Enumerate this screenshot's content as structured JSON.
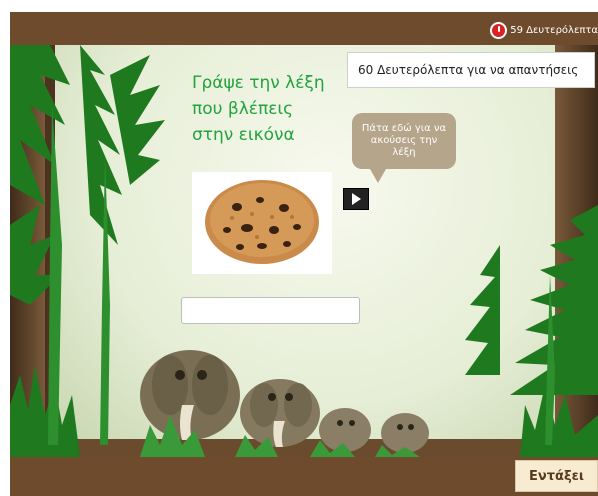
{
  "header": {
    "timer_text": "59 Δευτερόλεπτα",
    "icon": "stopwatch-icon"
  },
  "tooltip": {
    "text": "60 Δευτερόλεπτα για να απαντήσεις"
  },
  "exercise": {
    "instruction": "Γράψε την λέξη\nπου βλέπεις\nστην εικόνα",
    "audio_hint": "Πάτα εδώ για να ακούσεις την λέξη",
    "play_icon": "play-icon",
    "image_subject": "cookie",
    "answer_value": "",
    "answer_placeholder": ""
  },
  "footer": {
    "ok_label": "Εντάξει"
  },
  "colors": {
    "wood": "#6e4b2d",
    "title_green": "#22a33c",
    "bubble": "#b5a58a",
    "timer_red": "#d92222"
  }
}
